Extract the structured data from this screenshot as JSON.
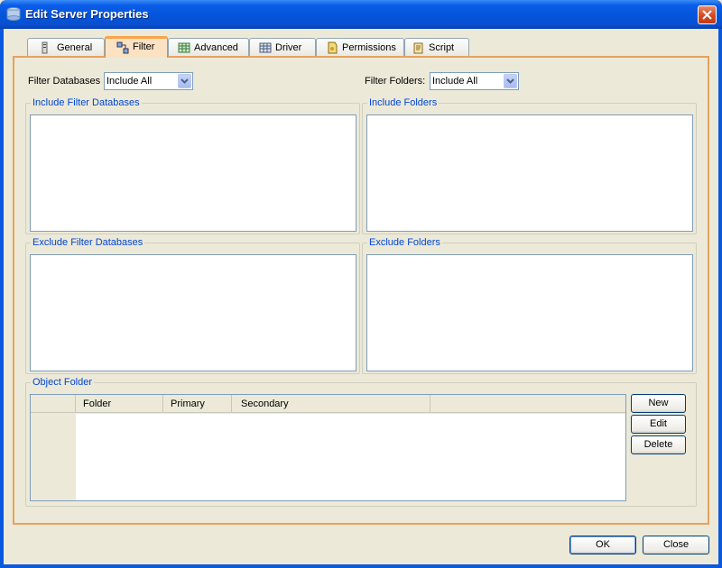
{
  "window": {
    "title": "Edit Server Properties"
  },
  "tabs": [
    {
      "label": "General",
      "icon": "general-icon"
    },
    {
      "label": "Filter",
      "icon": "filter-icon",
      "active": true
    },
    {
      "label": "Advanced",
      "icon": "advanced-icon"
    },
    {
      "label": "Driver",
      "icon": "driver-icon"
    },
    {
      "label": "Permissions",
      "icon": "permissions-icon"
    },
    {
      "label": "Script",
      "icon": "script-icon"
    }
  ],
  "filter": {
    "databases_label": "Filter Databases",
    "databases_value": "Include All",
    "folders_label": "Filter Folders:",
    "folders_value": "Include All"
  },
  "groups": {
    "include_databases": "Include Filter Databases",
    "include_folders": "Include Folders",
    "exclude_databases": "Exclude Filter Databases",
    "exclude_folders": "Exclude Folders",
    "object_folder": "Object Folder"
  },
  "object_folder": {
    "columns": [
      "Folder",
      "Primary",
      "Secondary"
    ],
    "buttons": {
      "new": "New",
      "edit": "Edit",
      "delete": "Delete"
    }
  },
  "footer": {
    "ok": "OK",
    "close": "Close"
  }
}
